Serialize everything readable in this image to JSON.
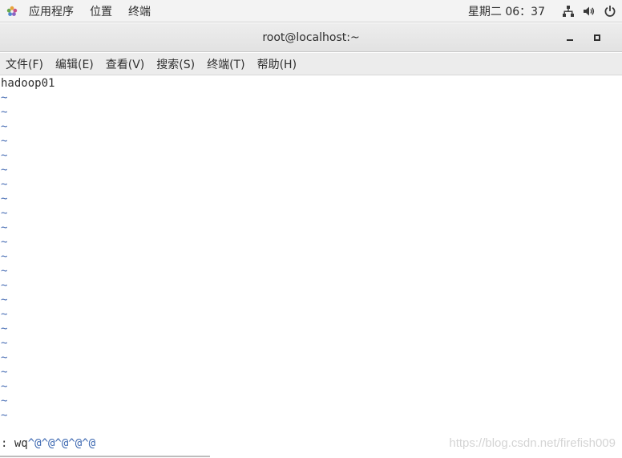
{
  "topbar": {
    "menus": [
      "应用程序",
      "位置",
      "终端"
    ],
    "clock": "星期二 06：37",
    "icons": [
      "network-icon",
      "volume-icon",
      "power-icon"
    ]
  },
  "window": {
    "title": "root@localhost:~"
  },
  "menubar": {
    "items": [
      "文件(F)",
      "编辑(E)",
      "查看(V)",
      "搜索(S)",
      "终端(T)",
      "帮助(H)"
    ]
  },
  "terminal": {
    "content_line": "hadoop01",
    "tilde_char": "~",
    "tilde_count": 23,
    "command_prefix": ": wq",
    "command_ctrl": "^@^@^@^@^@"
  },
  "watermark": "https://blog.csdn.net/firefish009",
  "colors": {
    "tilde": "#4a6fb5",
    "text": "#2e2e2e",
    "ctrl": "#3a66b0"
  }
}
